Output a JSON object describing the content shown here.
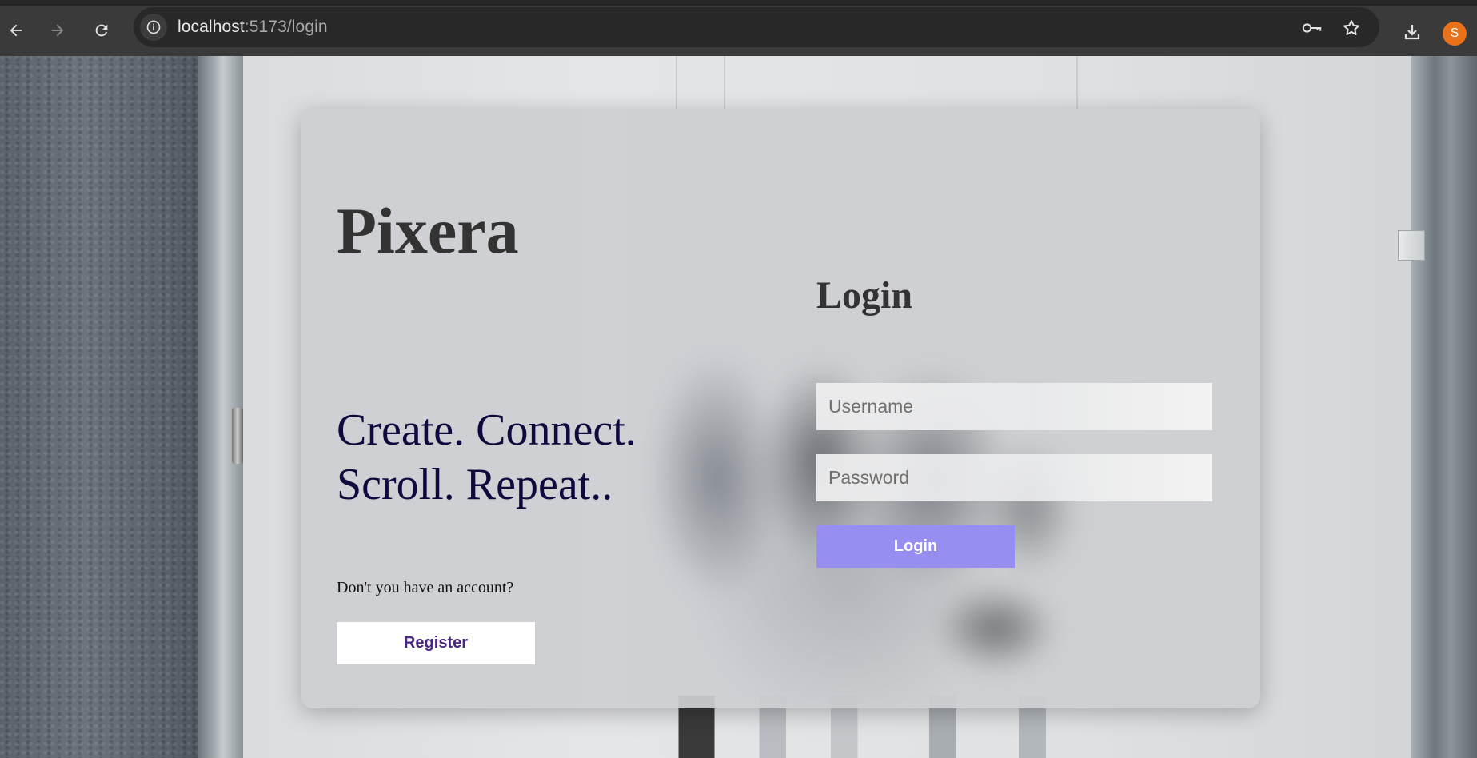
{
  "browser": {
    "url_host": "localhost",
    "url_path": ":5173/login",
    "avatar_initial": "S",
    "icons": {
      "back": "arrow-left-icon",
      "forward": "arrow-right-icon",
      "reload": "reload-icon",
      "site_info": "info-icon",
      "password_manager": "key-icon",
      "bookmark": "star-icon",
      "downloads": "download-icon"
    },
    "colors": {
      "avatar": "#e8711a"
    }
  },
  "brand": {
    "title": "Pixera"
  },
  "tagline": {
    "line1": "Create. Connect.",
    "line2": "Scroll. Repeat.."
  },
  "register": {
    "prompt": "Don't you have an account?",
    "button_label": "Register"
  },
  "login": {
    "heading": "Login",
    "username_placeholder": "Username",
    "username_value": "",
    "password_placeholder": "Password",
    "password_value": "",
    "button_label": "Login"
  },
  "colors": {
    "login_button": "#968ef0",
    "register_text": "#4b2682",
    "tagline_text": "#0e0a3e",
    "heading_text": "#333333"
  }
}
